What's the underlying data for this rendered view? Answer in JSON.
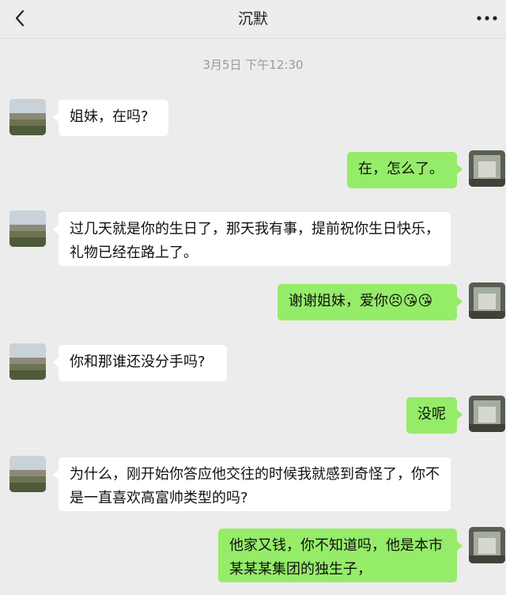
{
  "header": {
    "title": "沉默",
    "back_icon": "chevron-left-icon",
    "more_icon": "more-dots-icon"
  },
  "timestamp": "3月5日 下午12:30",
  "colors": {
    "incoming_bubble": "#ffffff",
    "outgoing_bubble": "#95ec69",
    "background": "#ececec"
  },
  "messages": [
    {
      "side": "in",
      "text": "姐妹，在吗?"
    },
    {
      "side": "out",
      "text": "在，怎么了。"
    },
    {
      "side": "in",
      "text": "过几天就是你的生日了，那天我有事，提前祝你生日快乐，礼物已经在路上了。"
    },
    {
      "side": "out",
      "text": "谢谢姐妹，爱你",
      "emojis": [
        "😣",
        "😘",
        "😘"
      ]
    },
    {
      "side": "in",
      "text": "你和那谁还没分手吗?"
    },
    {
      "side": "out",
      "text": "没呢"
    },
    {
      "side": "in",
      "text": "为什么，刚开始你答应他交往的时候我就感到奇怪了，你不是一直喜欢高富帅类型的吗?"
    },
    {
      "side": "out",
      "text": "他家又钱，你不知道吗，他是本市某某某集团的独生子，"
    }
  ]
}
